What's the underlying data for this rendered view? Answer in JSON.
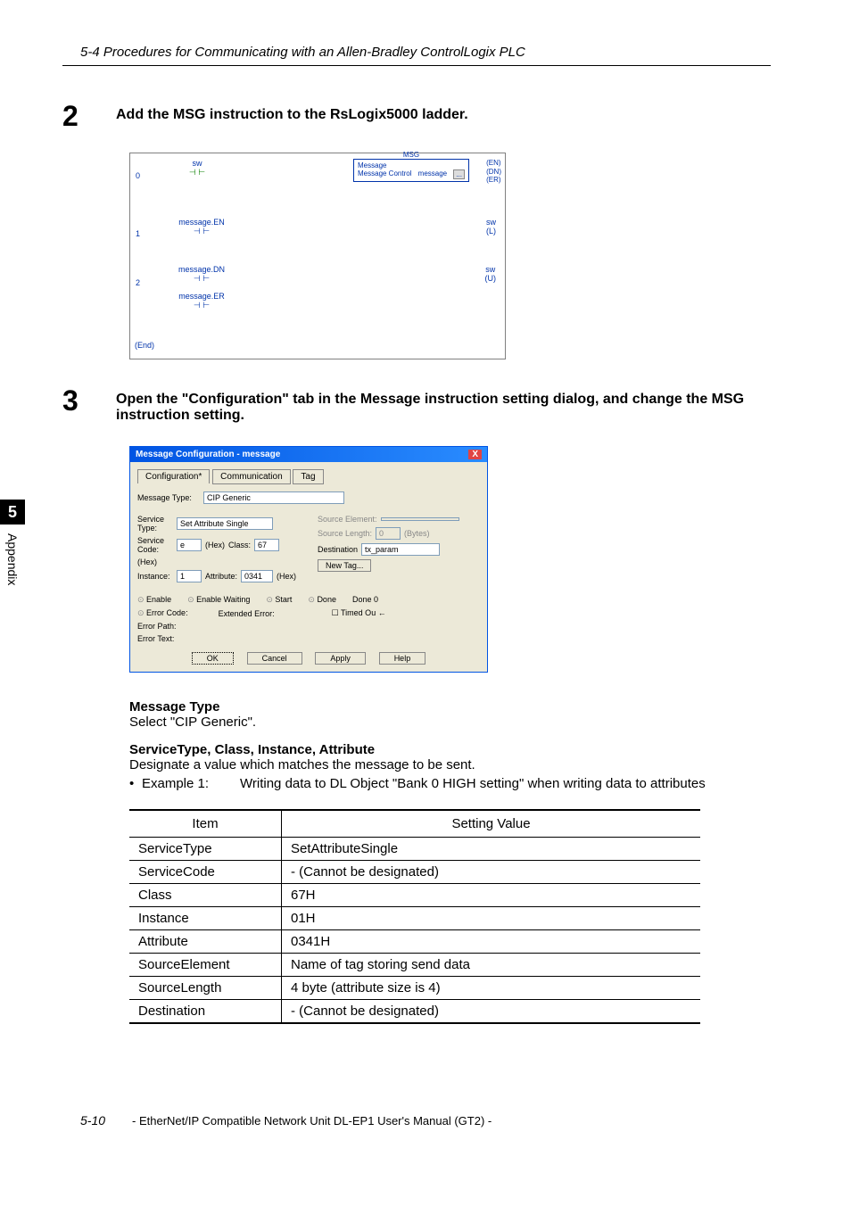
{
  "header": "5-4 Procedures for Communicating with an Allen-Bradley ControlLogix PLC",
  "side": {
    "num": "5",
    "label": "Appendix"
  },
  "step2": {
    "num": "2",
    "text": "Add the MSG instruction to the RsLogix5000 ladder."
  },
  "ladder": {
    "r0": {
      "num": "0",
      "contact": "sw",
      "block_l1": "Message",
      "block_l2": "Message Control",
      "block_tag": "message",
      "coils": [
        "(EN)",
        "(DN)",
        "(ER)"
      ],
      "msg_title": "MSG"
    },
    "r1": {
      "num": "1",
      "contact": "message.EN",
      "coil_tag": "sw",
      "coil": "(L)"
    },
    "r2": {
      "num": "2",
      "contact1": "message.DN",
      "contact2": "message.ER",
      "coil_tag": "sw",
      "coil": "(U)"
    },
    "end": "(End)"
  },
  "step3": {
    "num": "3",
    "text": "Open the \"Configuration\" tab in the Message instruction setting dialog, and change the MSG instruction setting."
  },
  "dialog": {
    "title": "Message Configuration - message",
    "tabs": [
      "Configuration*",
      "Communication",
      "Tag"
    ],
    "msg_type_label": "Message Type:",
    "msg_type_value": "CIP Generic",
    "svc_type_label": "Service Type:",
    "svc_type_value": "Set Attribute Single",
    "src_elem_label": "Source Element:",
    "src_len_label": "Source Length:",
    "src_len_value": "0",
    "bytes": "(Bytes)",
    "svc_code_label": "Service Code:",
    "svc_code_value": "e",
    "hex": "(Hex)",
    "class_label": "Class:",
    "class_value": "67",
    "dest_label": "Destination",
    "dest_value": "tx_param",
    "inst_label": "Instance:",
    "inst_value": "1",
    "attr_label": "Attribute:",
    "attr_value": "0341",
    "new_tag": "New Tag...",
    "status": {
      "enable": "Enable",
      "enable_wait": "Enable Waiting",
      "start": "Start",
      "done": "Done",
      "done_val": "Done        0"
    },
    "err_code": "Error Code:",
    "ext_err": "Extended Error:",
    "timed": "Timed Ou",
    "err_path": "Error Path:",
    "err_text": "Error Text:",
    "btns": {
      "ok": "OK",
      "cancel": "Cancel",
      "apply": "Apply",
      "help": "Help"
    }
  },
  "sections": {
    "msg_type_h": "Message Type",
    "msg_type_t": "Select \"CIP Generic\".",
    "stcia_h": "ServiceType, Class, Instance, Attribute",
    "stcia_t": "Designate a value which matches the message to be sent.",
    "ex1_bullet": "•",
    "ex1_label": "Example 1:",
    "ex1_text": "Writing data to DL Object \"Bank 0 HIGH setting\" when writing data to attributes"
  },
  "table": {
    "h1": "Item",
    "h2": "Setting Value",
    "rows": [
      {
        "c1": "ServiceType",
        "c2": "SetAttributeSingle"
      },
      {
        "c1": "ServiceCode",
        "c2": "- (Cannot be designated)"
      },
      {
        "c1": "Class",
        "c2": "67H"
      },
      {
        "c1": "Instance",
        "c2": "01H"
      },
      {
        "c1": "Attribute",
        "c2": "0341H"
      },
      {
        "c1": "SourceElement",
        "c2": "Name of tag storing send data"
      },
      {
        "c1": "SourceLength",
        "c2": "4 byte (attribute size is 4)"
      },
      {
        "c1": "Destination",
        "c2": "- (Cannot be designated)"
      }
    ]
  },
  "footer": {
    "page": "5-10",
    "name": "- EtherNet/IP Compatible Network Unit DL-EP1 User's Manual (GT2) -"
  }
}
